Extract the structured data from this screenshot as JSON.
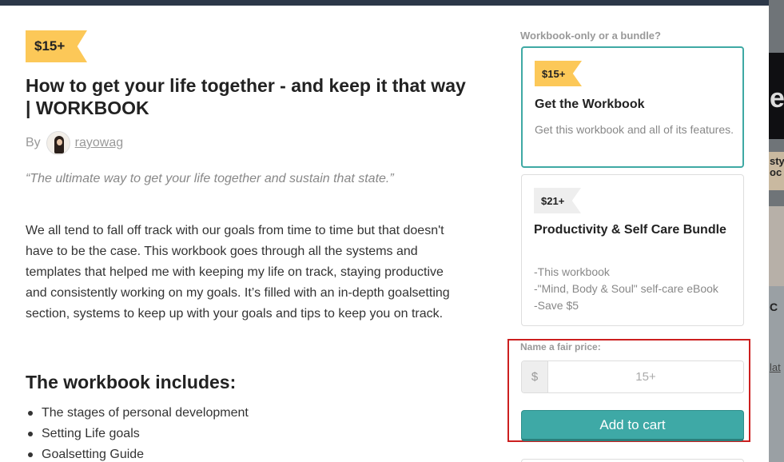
{
  "product": {
    "price_tag": "$15+",
    "title": "How to get your life together - and keep it that way | WORKBOOK",
    "by_label": "By",
    "author": "rayowag",
    "quote": "“The ultimate way to get your life together and sustain that state.”",
    "description": "We all tend to fall off track with our goals from time to time but that doesn't have to be the case. This workbook goes through all the systems and templates that helped me with keeping my life on track, staying productive and consistently working on my goals. It’s filled with an in-depth goalsetting section, systems to keep up with your goals and tips to keep you on track.",
    "includes_heading": "The workbook includes:",
    "includes": [
      "The stages of personal development",
      "Setting Life goals",
      "Goalsetting Guide"
    ]
  },
  "options": {
    "question": "Workbook-only or a bundle?",
    "items": [
      {
        "price": "$15+",
        "name": "Get the Workbook",
        "detail": "Get this workbook and all of its features.",
        "selected": true
      },
      {
        "price": "$21+",
        "name": "Productivity & Self Care Bundle",
        "detail_lines": [
          "-This workbook",
          "-\"Mind, Body & Soul\" self-care eBook",
          "-Save $5"
        ],
        "selected": false
      }
    ]
  },
  "purchase": {
    "fair_price_label": "Name a fair price:",
    "currency": "$",
    "price_placeholder": "15+",
    "add_to_cart_label": "Add to cart"
  },
  "background_page": {
    "fragments": [
      "es",
      "sty",
      "oc",
      "C",
      "lat"
    ]
  },
  "colors": {
    "tag_yellow": "#fcc858",
    "accent_teal": "#3ea9a6",
    "selected_border": "#3fa9a4",
    "highlight_red": "#cc1f1f"
  }
}
